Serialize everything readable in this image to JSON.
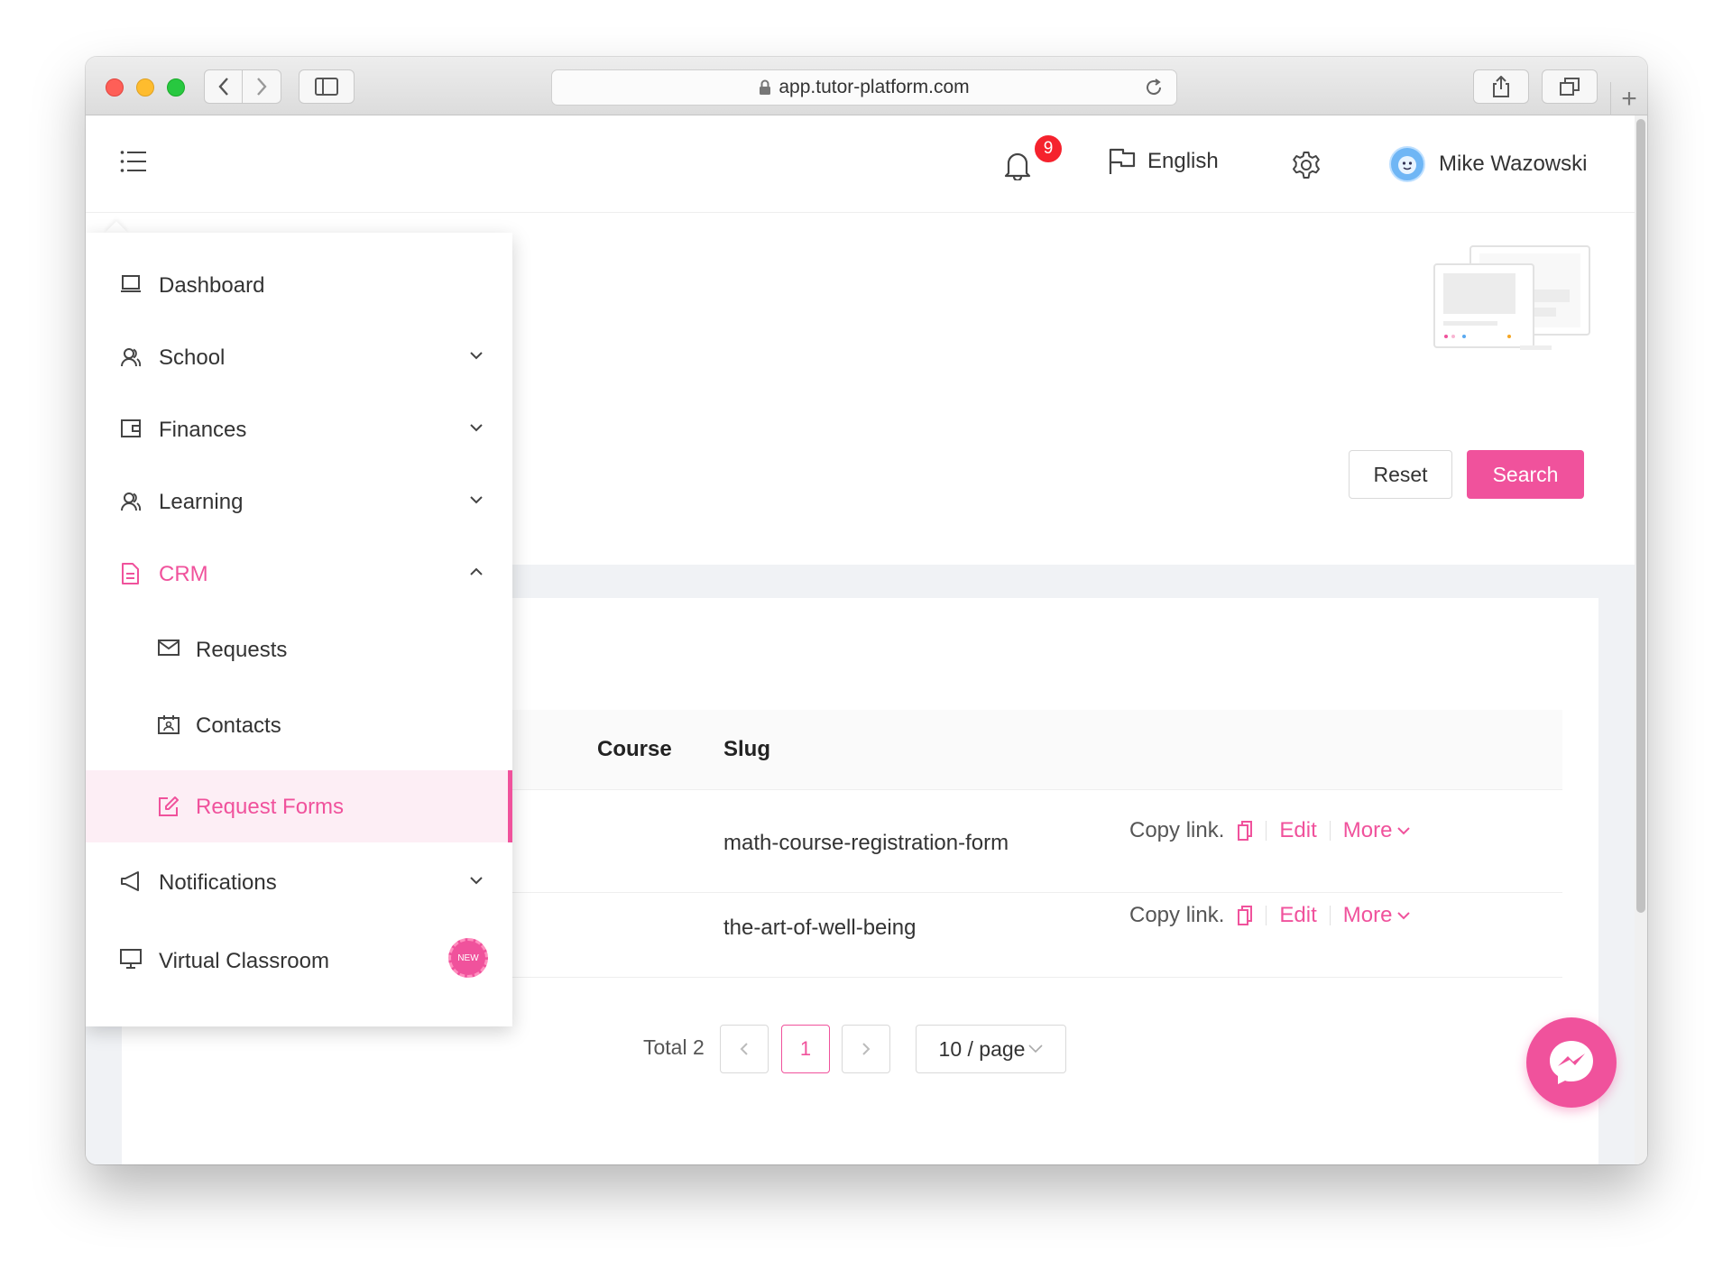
{
  "browser": {
    "url": "app.tutor-platform.com"
  },
  "header": {
    "notification_count": "9",
    "language": "English",
    "user_name": "Mike Wazowski"
  },
  "filters": {
    "reset_label": "Reset",
    "search_label": "Search"
  },
  "menu": {
    "items": [
      {
        "label": "Dashboard",
        "icon": "laptop-icon"
      },
      {
        "label": "School",
        "icon": "users-icon"
      },
      {
        "label": "Finances",
        "icon": "wallet-icon"
      },
      {
        "label": "Learning",
        "icon": "users-icon"
      },
      {
        "label": "CRM",
        "icon": "document-icon"
      },
      {
        "label": "Requests",
        "icon": "mail-icon"
      },
      {
        "label": "Contacts",
        "icon": "contact-card-icon"
      },
      {
        "label": "Request Forms",
        "icon": "edit-icon"
      },
      {
        "label": "Notifications",
        "icon": "megaphone-icon"
      },
      {
        "label": "Virtual Classroom",
        "icon": "monitor-icon"
      }
    ],
    "new_badge": "NEW"
  },
  "table": {
    "columns": [
      "Course",
      "Slug"
    ],
    "rows": [
      {
        "slug": "math-course-registration-form"
      },
      {
        "slug": "the-art-of-well-being"
      }
    ],
    "actions": {
      "copy": "Copy link.",
      "edit": "Edit",
      "more": "More"
    }
  },
  "pagination": {
    "total": "Total 2",
    "current": "1",
    "page_size": "10 / page"
  },
  "colors": {
    "accent": "#f0529c",
    "badge": "#f5222d"
  }
}
